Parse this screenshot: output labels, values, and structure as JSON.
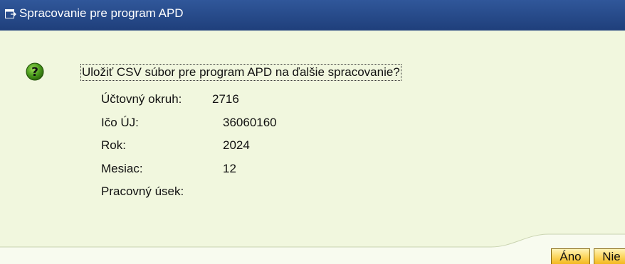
{
  "window": {
    "title": "Spracovanie pre program APD",
    "title_icon": "dialog-window-icon"
  },
  "dialog": {
    "icon": "question-mark-icon",
    "question": "Uložiť CSV súbor pre program APD na ďalšie spracovanie?",
    "fields": [
      {
        "label": "Účtovný okruh:",
        "value": "2716"
      },
      {
        "label": "Ičo ÚJ:",
        "value": "36060160"
      },
      {
        "label": "Rok:",
        "value": "2024"
      },
      {
        "label": "Mesiac:",
        "value": "12"
      },
      {
        "label": "Pracovný úsek:",
        "value": ""
      }
    ]
  },
  "buttons": {
    "yes_label": "Áno",
    "no_label": "Nie"
  },
  "colors": {
    "title_bar": "#1f3f7b",
    "background": "#f1f7de",
    "button": "#fcd45a",
    "icon_green": "#4a9a1c"
  }
}
